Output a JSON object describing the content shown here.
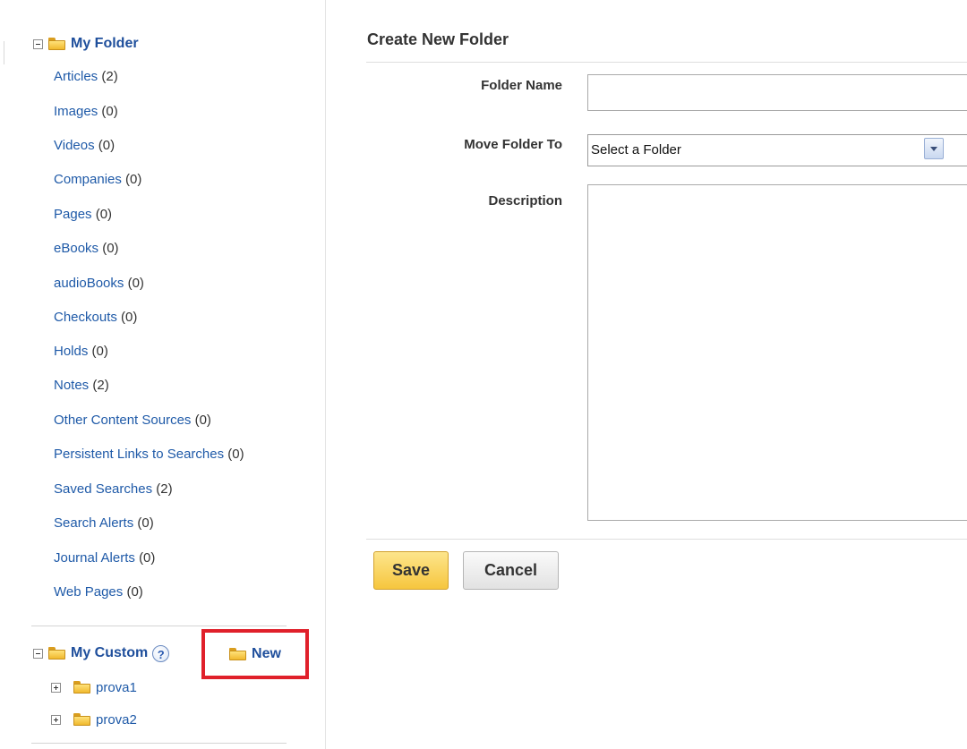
{
  "sidebar": {
    "my_folder": {
      "label": "My Folder",
      "items": [
        {
          "label": "Articles",
          "count": "(2)"
        },
        {
          "label": "Images",
          "count": "(0)"
        },
        {
          "label": "Videos",
          "count": "(0)"
        },
        {
          "label": "Companies",
          "count": "(0)"
        },
        {
          "label": "Pages",
          "count": "(0)"
        },
        {
          "label": "eBooks",
          "count": "(0)"
        },
        {
          "label": "audioBooks",
          "count": "(0)"
        },
        {
          "label": "Checkouts",
          "count": "(0)"
        },
        {
          "label": "Holds",
          "count": "(0)"
        },
        {
          "label": "Notes",
          "count": "(2)"
        },
        {
          "label": "Other Content Sources",
          "count": "(0)"
        },
        {
          "label": "Persistent Links to Searches",
          "count": "(0)"
        },
        {
          "label": "Saved Searches",
          "count": "(2)"
        },
        {
          "label": "Search Alerts",
          "count": "(0)"
        },
        {
          "label": "Journal Alerts",
          "count": "(0)"
        },
        {
          "label": "Web Pages",
          "count": "(0)"
        }
      ]
    },
    "my_custom": {
      "label": "My Custom",
      "help": "?",
      "new_label": "New",
      "subfolders": [
        {
          "label": "prova1"
        },
        {
          "label": "prova2"
        }
      ]
    }
  },
  "form": {
    "title": "Create New Folder",
    "folder_name_label": "Folder Name",
    "folder_name_value": "",
    "move_to_label": "Move Folder To",
    "move_to_selected": "Select a Folder",
    "description_label": "Description",
    "description_value": "",
    "save_label": "Save",
    "cancel_label": "Cancel"
  },
  "colors": {
    "link": "#1f5aa8",
    "highlight_box": "#e0202a",
    "save_button": "#f6c63e"
  }
}
